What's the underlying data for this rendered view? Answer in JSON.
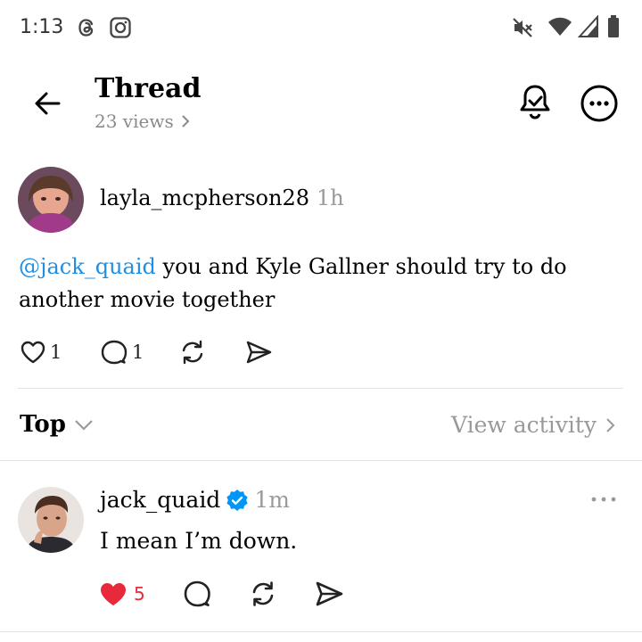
{
  "status_bar": {
    "time": "1:13",
    "left_icons": [
      "threads-icon",
      "instagram-icon"
    ],
    "right_icons": [
      "mute-icon",
      "wifi-icon",
      "signal-icon",
      "battery-icon"
    ]
  },
  "header": {
    "title": "Thread",
    "views": "23 views"
  },
  "post": {
    "username": "layla_mcpherson28",
    "time": "1h",
    "mention": "@jack_quaid",
    "text": " you and Kyle Gallner should try to do another movie together",
    "likes": "1",
    "replies": "1"
  },
  "sort_bar": {
    "sort_label": "Top",
    "activity_label": "View activity"
  },
  "reply": {
    "username": "jack_quaid",
    "verified": true,
    "time": "1m",
    "text": "I mean I’m down.",
    "likes": "5",
    "liked": true
  },
  "colors": {
    "mention": "#1f8fe6",
    "verified": "#0095f6",
    "like": "#e8293b",
    "muted_text": "#9a9a9a"
  }
}
